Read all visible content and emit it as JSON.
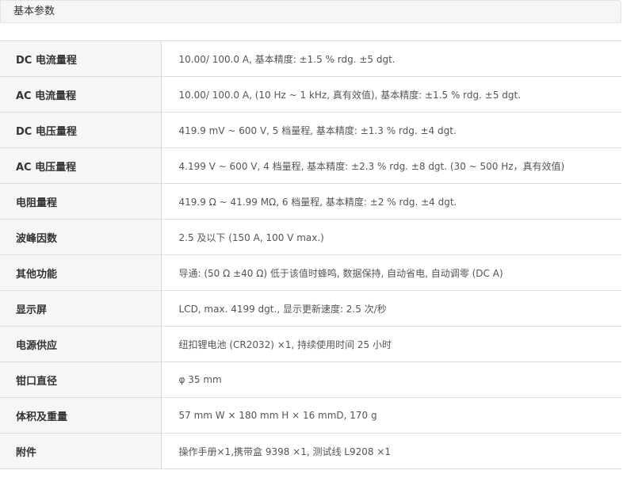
{
  "tab": {
    "title": "基本参数"
  },
  "specs": [
    {
      "label": "DC 电流量程",
      "value": "10.00/ 100.0 A, 基本精度: ±1.5 % rdg. ±5 dgt."
    },
    {
      "label": "AC 电流量程",
      "value": "10.00/ 100.0 A, (10 Hz ~ 1 kHz, 真有效值), 基本精度: ±1.5 % rdg. ±5 dgt."
    },
    {
      "label": "DC 电压量程",
      "value": "419.9 mV ~ 600 V, 5 档量程, 基本精度: ±1.3 % rdg. ±4 dgt."
    },
    {
      "label": "AC 电压量程",
      "value": "4.199 V ~ 600 V, 4 档量程, 基本精度: ±2.3 % rdg. ±8 dgt. (30 ~ 500 Hz，真有效值)"
    },
    {
      "label": "电阻量程",
      "value": "419.9 Ω ~ 41.99 MΩ, 6 档量程, 基本精度: ±2 % rdg. ±4 dgt."
    },
    {
      "label": "波峰因数",
      "value": "2.5 及以下 (150 A, 100 V max.)"
    },
    {
      "label": "其他功能",
      "value": "导通: (50 Ω ±40 Ω) 低于该值时蜂鸣, 数据保持, 自动省电, 自动调零 (DC A)"
    },
    {
      "label": "显示屏",
      "value": "LCD, max. 4199 dgt., 显示更新速度: 2.5 次/秒"
    },
    {
      "label": "电源供应",
      "value": "纽扣锂电池 (CR2032) ×1, 持续使用时间 25 小时"
    },
    {
      "label": "钳口直径",
      "value": "φ 35 mm"
    },
    {
      "label": "体积及重量",
      "value": "57 mm W × 180 mm H × 16 mmD, 170 g"
    },
    {
      "label": "附件",
      "value": "操作手册×1,携带盒 9398 ×1, 测试线 L9208 ×1"
    }
  ]
}
